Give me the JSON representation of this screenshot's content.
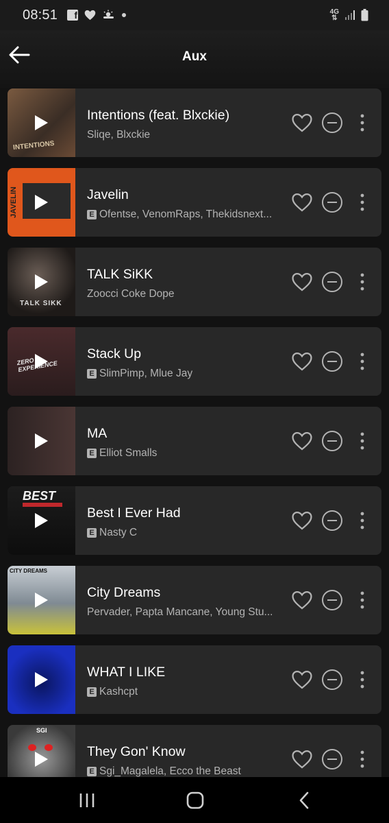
{
  "status_bar": {
    "time": "08:51",
    "network": "4G",
    "left_icons": [
      "facebook-icon",
      "heart-icon",
      "weather-icon",
      "dot-icon"
    ],
    "right_icons": [
      "network-4g-icon",
      "signal-icon",
      "battery-icon"
    ]
  },
  "header": {
    "title": "Aux",
    "back_icon": "arrow-left-icon"
  },
  "colors": {
    "background": "#121212",
    "card": "#282828",
    "secondary_text": "#b3b3b3"
  },
  "tracks": [
    {
      "title": "Intentions (feat. Blxckie)",
      "artists": "Sliqe, Blxckie",
      "explicit": false,
      "art_color": "#5a4535",
      "art_text": "INTENTIONS"
    },
    {
      "title": "Javelin",
      "artists": "Ofentse, VenomRaps, Thekidsnext...",
      "explicit": true,
      "art_color": "#e0571c",
      "art_text": "JAVELIN"
    },
    {
      "title": "TALK SiKK",
      "artists": "Zoocci Coke Dope",
      "explicit": false,
      "art_color": "#2a2522",
      "art_text": "TALK SIKK"
    },
    {
      "title": "Stack Up",
      "artists": "SlimPimp, Mlue Jay",
      "explicit": true,
      "art_color": "#3a2426",
      "art_text": "ZERO EXPERIENCE"
    },
    {
      "title": "MA",
      "artists": "Elliot Smalls",
      "explicit": true,
      "art_color": "#3b2c2b",
      "art_text": ""
    },
    {
      "title": "Best I Ever Had",
      "artists": "Nasty C",
      "explicit": true,
      "art_color": "#161616",
      "art_text": "BEST"
    },
    {
      "title": "City Dreams",
      "artists": "Pervader, Papta Mancane, Young Stu...",
      "explicit": false,
      "art_color": "#8a96a0",
      "art_text": "CITY DREAMS"
    },
    {
      "title": "WHAT I LIKE",
      "artists": "Kashcpt",
      "explicit": true,
      "art_color": "#1a2fc0",
      "art_text": ""
    },
    {
      "title": "They Gon' Know",
      "artists": "Sgi_Magalela, Ecco the Beast",
      "explicit": true,
      "art_color": "#5a5a5a",
      "art_text": "SGI"
    }
  ],
  "nav_bar": {
    "icons": [
      "recent-apps-icon",
      "home-icon",
      "back-nav-icon"
    ]
  }
}
